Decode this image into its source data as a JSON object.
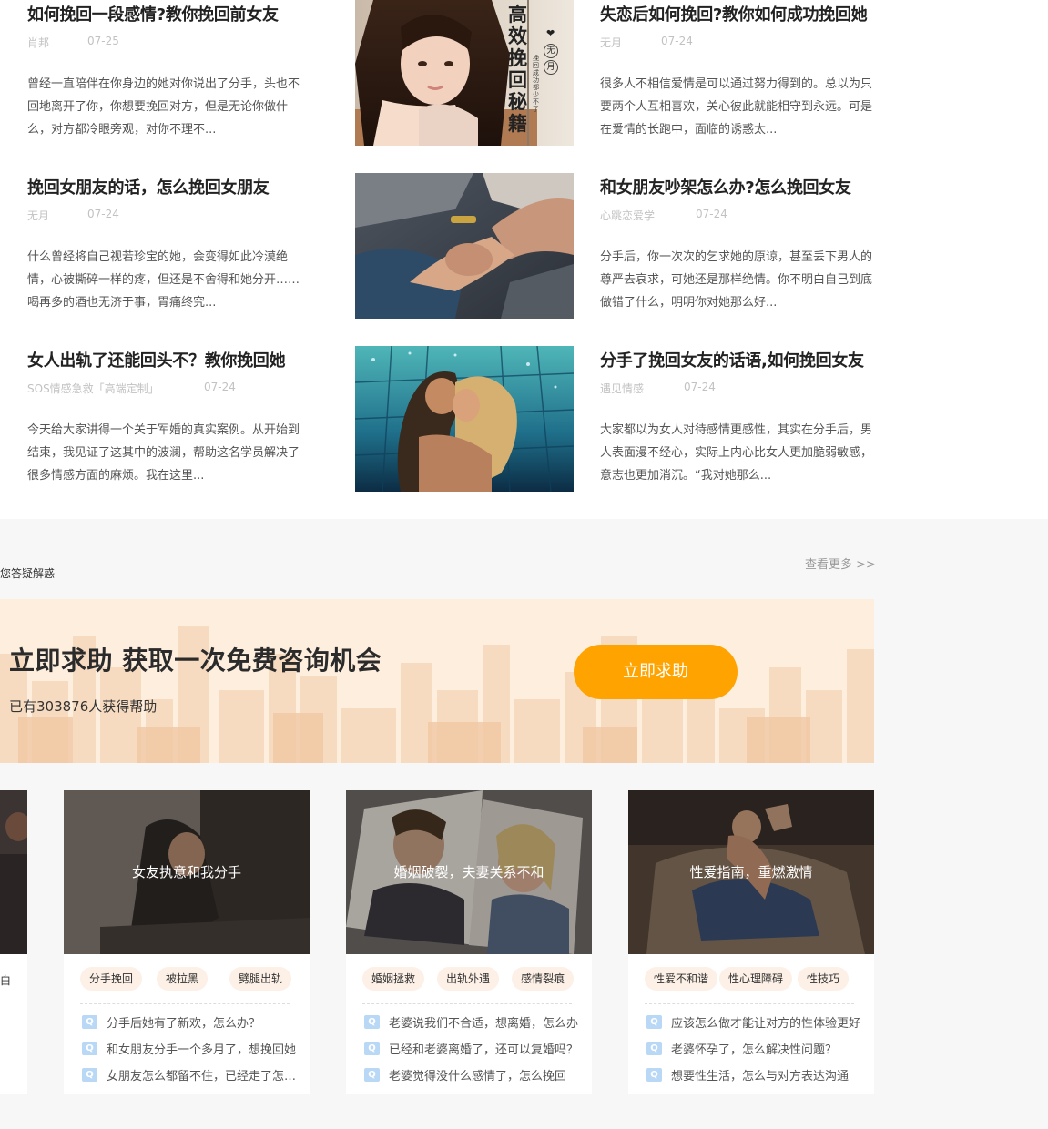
{
  "articles": [
    {
      "title": "如何挽回一段感情?教你挽回前女友",
      "author": "肖邦",
      "date": "07-25",
      "summary": "曾经一直陪伴在你身边的她对你说出了分手，头也不回地离开了你，你想要挽回对方，但是无论你做什么，对方都冷眼旁观，对你不理不..."
    },
    {
      "title": "失恋后如何挽回?教你如何成功挽回她",
      "author": "无月",
      "date": "07-24",
      "summary": "很多人不相信爱情是可以通过努力得到的。总以为只要两个人互相喜欢，关心彼此就能相守到永远。可是在爱情的长跑中，面临的诱惑太..."
    },
    {
      "title": "挽回女朋友的话，怎么挽回女朋友",
      "author": "无月",
      "date": "07-24",
      "summary": "什么曾经将自己视若珍宝的她，会变得如此冷漠绝情，心被撕碎一样的疼，但还是不舍得和她分开……喝再多的酒也无济于事，胃痛终究..."
    },
    {
      "title": "和女朋友吵架怎么办?怎么挽回女友",
      "author": "心跳恋爱学",
      "date": "07-24",
      "summary": "分手后，你一次次的乞求她的原谅，甚至丢下男人的尊严去哀求，可她还是那样绝情。你不明白自己到底做错了什么，明明你对她那么好..."
    },
    {
      "title": "女人出轨了还能回头不？教你挽回她",
      "author": "SOS情感急救「高端定制」",
      "date": "07-24",
      "summary": "今天给大家讲得一个关于军婚的真实案例。从开始到结束，我见证了这其中的波澜，帮助这名学员解决了很多情感方面的麻烦。我在这里..."
    },
    {
      "title": "分手了挽回女友的话语,如何挽回女友",
      "author": "遇见情感",
      "date": "07-24",
      "summary": "大家都以为女人对待感情更感性，其实在分手后，男人表面漫不经心，实际上内心比女人更加脆弱敏感，意志也更加消沉。“我对她那么..."
    }
  ],
  "book_cover": {
    "title": "高效挽回秘籍",
    "badge_top": "无",
    "badge_bottom": "月",
    "subtitle": "挽回成功都少不了",
    "heart": "❤"
  },
  "help_section": {
    "subtitle": "您答疑解惑",
    "see_more": "查看更多 >>",
    "banner_title": "立即求助 获取一次免费咨询机会",
    "banner_count": "已有303876人获得帮助",
    "banner_button": "立即求助",
    "partial_card": {
      "tag": "白"
    },
    "cards": [
      {
        "title": "女友执意和我分手",
        "tags": [
          "分手挽回",
          "被拉黑",
          "劈腿出轨"
        ],
        "questions": [
          "分手后她有了新欢，怎么办？",
          "和女朋友分手一个多月了，想挽回她",
          "女朋友怎么都留不住，已经走了怎么办"
        ]
      },
      {
        "title": "婚姻破裂，夫妻关系不和",
        "tags": [
          "婚姻拯救",
          "出轨外遇",
          "感情裂痕"
        ],
        "questions": [
          "老婆说我们不合适，想离婚，怎么办",
          "已经和老婆离婚了，还可以复婚吗？",
          "老婆觉得没什么感情了，怎么挽回"
        ]
      },
      {
        "title": "性爱指南，重燃激情",
        "tags": [
          "性爱不和谐",
          "性心理障碍",
          "性技巧"
        ],
        "questions": [
          "应该怎么做才能让对方的性体验更好",
          "老婆怀孕了，怎么解决性问题？",
          "想要性生活，怎么与对方表达沟通"
        ]
      }
    ]
  },
  "colors": {
    "accent_orange": "#ffa300",
    "banner_bg": "#fdeede",
    "tag_bg": "#fdf0e6",
    "section_bg": "#f7f7f7",
    "q_icon": "#b9d8f5"
  },
  "icons": {
    "question": "q-icon"
  }
}
